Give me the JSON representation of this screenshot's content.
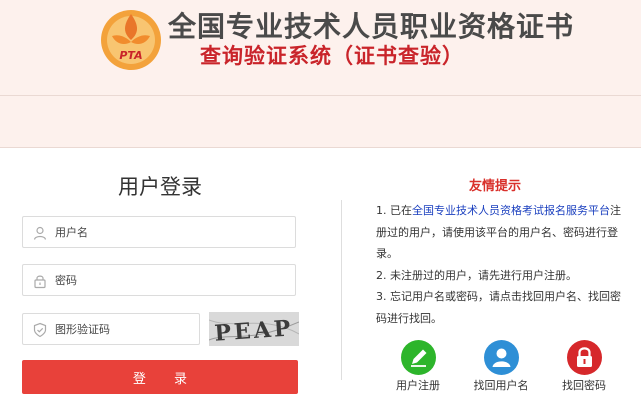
{
  "header": {
    "logo_text": "PTA",
    "title": "全国专业技术人员职业资格证书",
    "subtitle": "查询验证系统（证书查验）"
  },
  "login": {
    "title": "用户登录",
    "username_placeholder": "用户名",
    "password_placeholder": "密码",
    "captcha_placeholder": "图形验证码",
    "captcha_text": "PEAP",
    "submit_label": "登 录"
  },
  "tips": {
    "title": "友情提示",
    "item1_prefix": "1. 已在",
    "item1_link": "全国专业技术人员资格考试报名服务平台",
    "item1_suffix": "注册过的用户，请使用该平台的用户名、密码进行登录。",
    "item2": "2. 未注册过的用户，请先进行用户注册。",
    "item3": "3. 忘记用户名或密码，请点击找回用户名、找回密码进行找回。"
  },
  "actions": [
    {
      "label": "用户注册",
      "icon": "pencil-icon",
      "color": "#2db52b"
    },
    {
      "label": "找回用户名",
      "icon": "user-icon",
      "color": "#2e8fd6"
    },
    {
      "label": "找回密码",
      "icon": "lock-icon",
      "color": "#d6282b"
    }
  ],
  "colors": {
    "header_bg": "#fdf1ed",
    "accent_red": "#e8413a",
    "title_red": "#c9242a",
    "link_blue": "#1a3fbf"
  }
}
